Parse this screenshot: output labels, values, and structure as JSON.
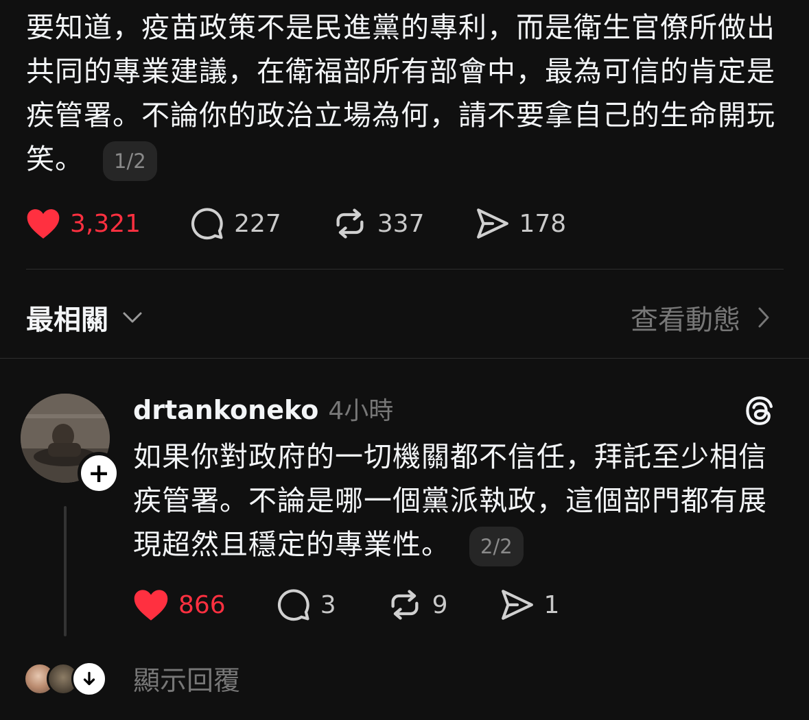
{
  "post": {
    "text": "要知道，疫苗政策不是民進黨的專利，而是衛生官僚所做出共同的專業建議，在衛福部所有部會中，最為可信的肯定是疾管署。不論你的政治立場為何，請不要拿自己的生命開玩笑。",
    "page_indicator": "1/2",
    "likes": "3,321",
    "comments": "227",
    "reposts": "337",
    "shares": "178"
  },
  "filter": {
    "label": "最相關",
    "view_activity": "查看動態"
  },
  "reply": {
    "username": "drtankoneko",
    "time": "4小時",
    "text": "如果你對政府的一切機關都不信任，拜託至少相信疾管署。不論是哪一個黨派執政，這個部門都有展現超然且穩定的專業性。",
    "page_indicator": "2/2",
    "likes": "866",
    "comments": "3",
    "reposts": "9",
    "shares": "1",
    "show_replies": "顯示回覆"
  },
  "colors": {
    "background": "#101010",
    "like_red": "#ff3040",
    "text_primary": "#f3f5f7",
    "text_secondary": "#777777"
  },
  "icons": [
    "heart-icon",
    "comment-icon",
    "repost-icon",
    "share-icon",
    "chevron-down-icon",
    "chevron-right-icon",
    "threads-logo-icon",
    "plus-icon",
    "arrow-down-icon"
  ]
}
